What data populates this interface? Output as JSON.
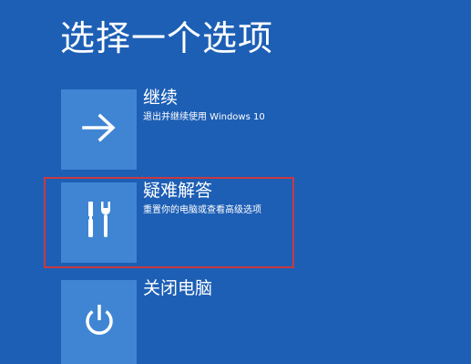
{
  "screen": {
    "title": "选择一个选项",
    "background_color": "#1d5fb5",
    "tile_color": "#3f85d3",
    "highlight_color": "#c9393f"
  },
  "options": [
    {
      "label": "继续",
      "description": "退出并继续使用 Windows 10",
      "icon": "arrow-right-icon"
    },
    {
      "label": "疑难解答",
      "description": "重置你的电脑或查看高级选项",
      "icon": "tools-icon",
      "highlighted": true
    },
    {
      "label": "关闭电脑",
      "description": "",
      "icon": "power-icon"
    }
  ]
}
